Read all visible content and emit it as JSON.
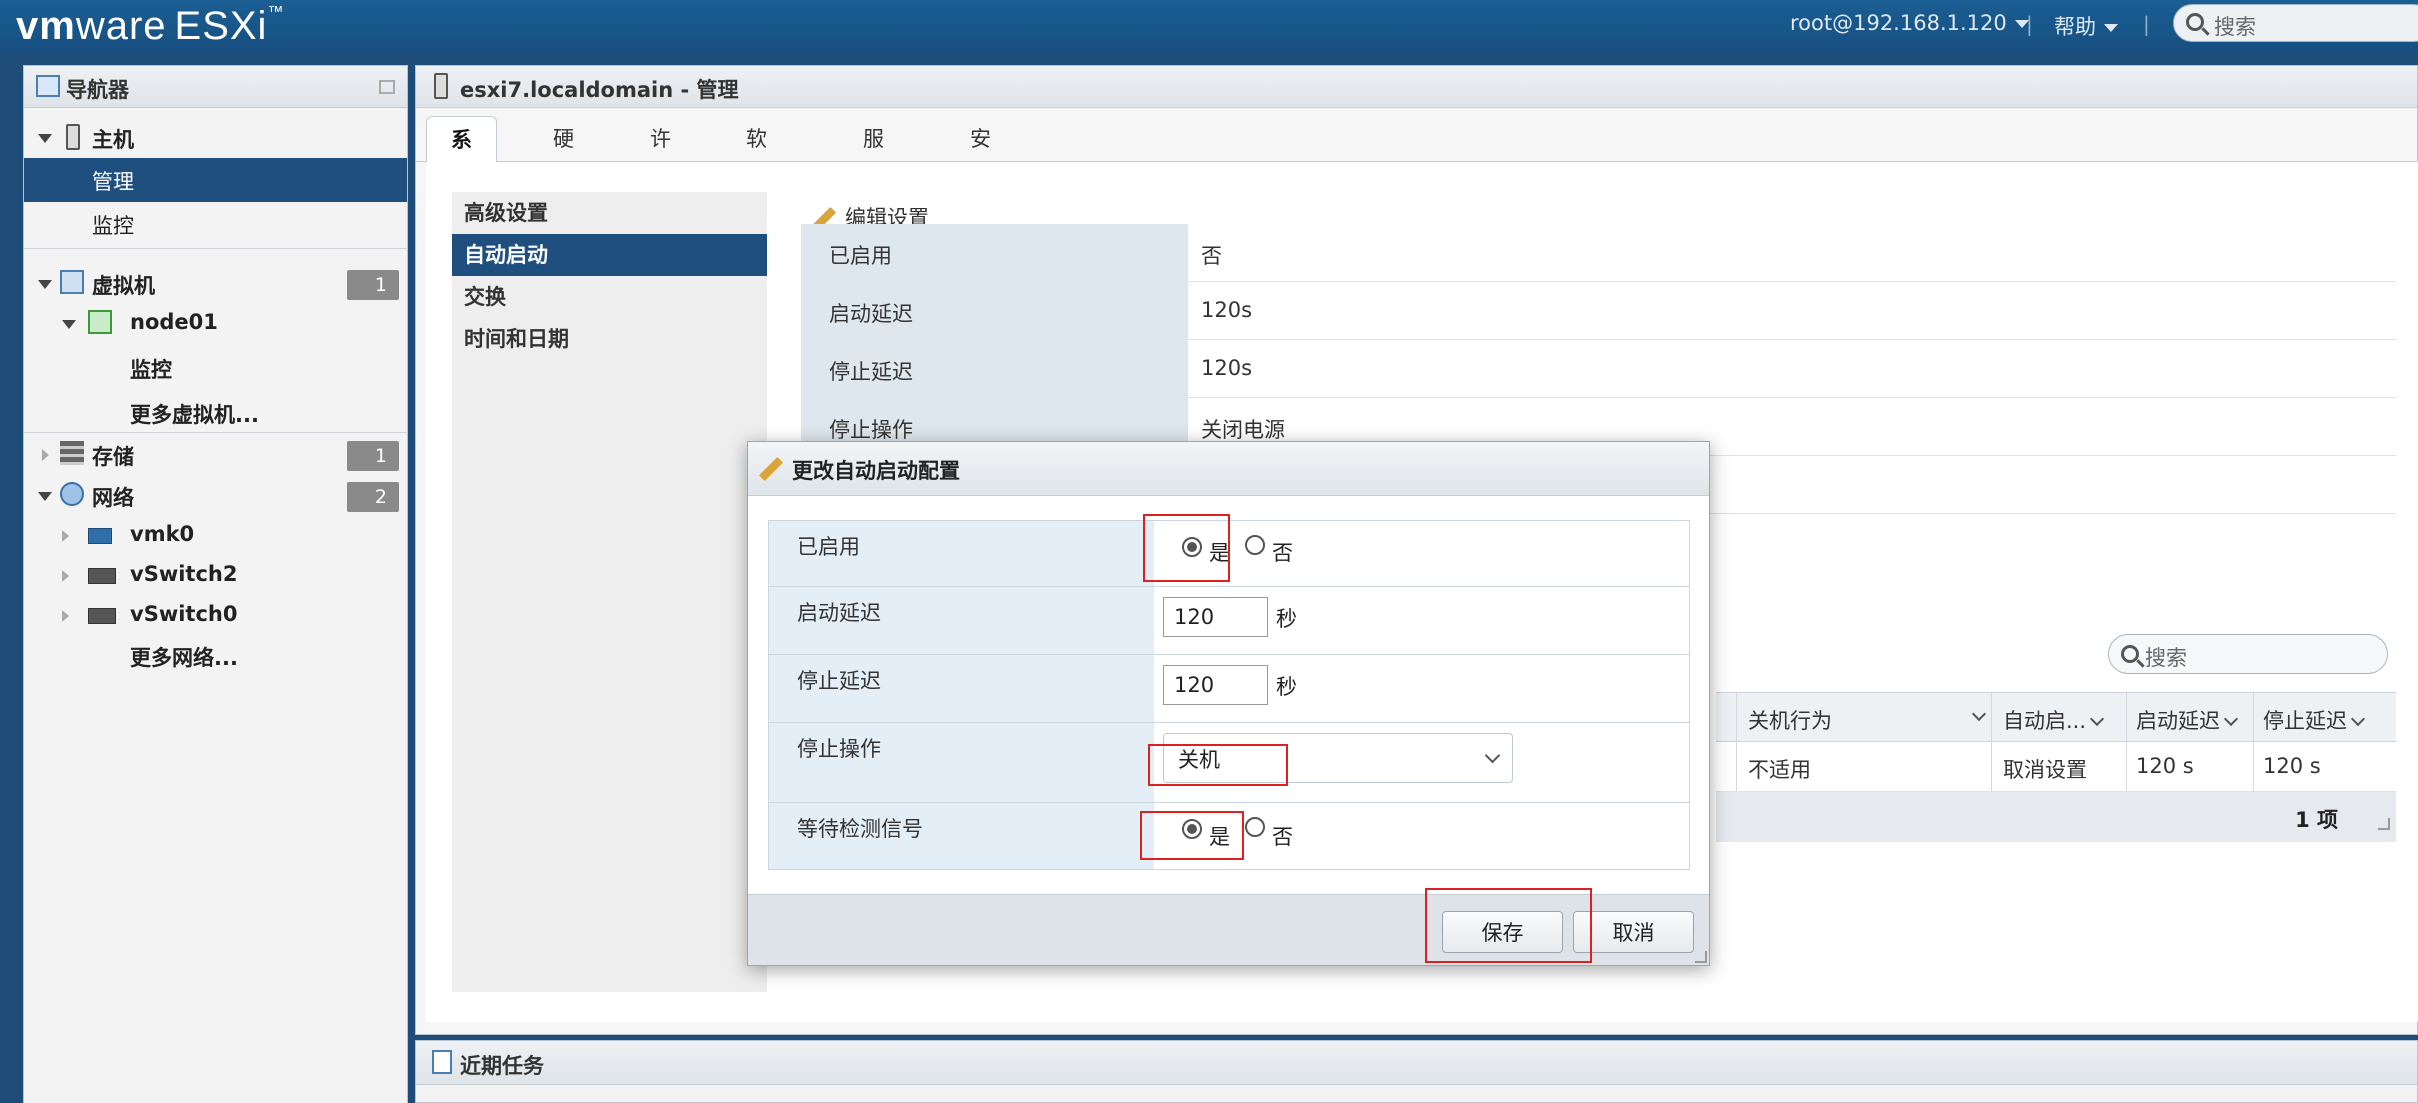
{
  "topbar": {
    "logo_vm": "vm",
    "logo_ware": "ware",
    "logo_product": "ESXi",
    "logo_tm": "™",
    "user": "root@192.168.1.120",
    "help": "帮助",
    "search_placeholder": "搜索",
    "separator": "|"
  },
  "navigator": {
    "title": "导航器",
    "host": "主机",
    "manage": "管理",
    "monitor": "监控",
    "vms": "虚拟机",
    "vms_count": "1",
    "vm_node": "node01",
    "vm_monitor": "监控",
    "more_vms": "更多虚拟机...",
    "storage": "存储",
    "storage_count": "1",
    "network": "网络",
    "network_count": "2",
    "net_items": [
      "vmk0",
      "vSwitch2",
      "vSwitch0"
    ],
    "more_networks": "更多网络..."
  },
  "main": {
    "title": "esxi7.localdomain - 管理",
    "tabs": [
      "系统",
      "硬件",
      "许可",
      "软件包",
      "服务",
      "安全和用户"
    ],
    "side_items": [
      "高级设置",
      "自动启动",
      "交换",
      "时间和日期"
    ],
    "edit_settings": "编辑设置",
    "kv": [
      {
        "k": "已启用",
        "v": "否"
      },
      {
        "k": "启动延迟",
        "v": "120s"
      },
      {
        "k": "停止延迟",
        "v": "120s"
      },
      {
        "k": "停止操作",
        "v": "关闭电源"
      }
    ],
    "search_placeholder": "搜索",
    "grid_headers": [
      "关机行为",
      "自动启...",
      "启动延迟",
      "停止延迟"
    ],
    "grid_row": [
      "不适用",
      "取消设置",
      "120 s",
      "120 s"
    ],
    "grid_count": "1 项"
  },
  "tasks": {
    "title": "近期任务"
  },
  "dialog": {
    "title": "更改自动启动配置",
    "enabled_label": "已启用",
    "yes": "是",
    "no": "否",
    "start_delay_label": "启动延迟",
    "start_delay_value": "120",
    "stop_delay_label": "停止延迟",
    "stop_delay_value": "120",
    "seconds": "秒",
    "stop_action_label": "停止操作",
    "stop_action_value": "关机",
    "wait_heartbeat_label": "等待检测信号",
    "save": "保存",
    "cancel": "取消"
  }
}
